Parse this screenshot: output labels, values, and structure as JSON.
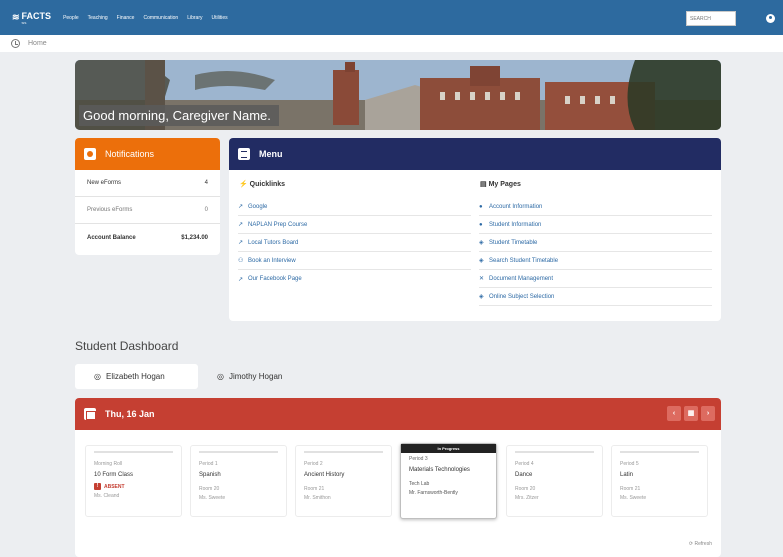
{
  "topbar": {
    "logo": "FACTS",
    "logo_sub": "SIS",
    "nav": [
      "People",
      "Teaching",
      "Finance",
      "Communication",
      "Library",
      "Utilities"
    ],
    "search_placeholder": "SEARCH"
  },
  "breadcrumb": {
    "label": "Home"
  },
  "banner": {
    "greeting": "Good morning, Caregiver Name."
  },
  "notifications": {
    "title": "Notifications",
    "rows": [
      {
        "label": "New eForms",
        "value": "4"
      },
      {
        "label": "Previous eForms",
        "value": "0"
      },
      {
        "label": "Account Balance",
        "value": "$1,234.00"
      }
    ]
  },
  "menu": {
    "title": "Menu",
    "quicklinks": {
      "title": "Quicklinks",
      "items": [
        {
          "icon": "external-link-icon",
          "label": "Google"
        },
        {
          "icon": "external-link-icon",
          "label": "NAPLAN Prep Course"
        },
        {
          "icon": "external-link-icon",
          "label": "Local Tutors Board"
        },
        {
          "icon": "group-icon",
          "label": "Book an Interview"
        },
        {
          "icon": "external-link-icon",
          "label": "Our Facebook Page"
        }
      ]
    },
    "mypages": {
      "title": "My Pages",
      "items": [
        {
          "icon": "account-icon",
          "label": "Account Information"
        },
        {
          "icon": "user-icon",
          "label": "Student Information"
        },
        {
          "icon": "timetable-icon",
          "label": "Student Timetable"
        },
        {
          "icon": "timetable-icon",
          "label": "Search Student Timetable"
        },
        {
          "icon": "document-icon",
          "label": "Document Management"
        },
        {
          "icon": "subject-icon",
          "label": "Online Subject Selection"
        }
      ]
    }
  },
  "dashboard": {
    "title": "Student Dashboard",
    "students": [
      "Elizabeth Hogan",
      "Jimothy Hogan"
    ],
    "date": "Thu, 16 Jan",
    "refresh": "Refresh",
    "periods": [
      {
        "name": "Morning Roll",
        "class": "10 Form Class",
        "status": "ABSENT",
        "room": "",
        "teacher": "Ms. Cleand"
      },
      {
        "name": "Period 1",
        "class": "Spanish",
        "room": "Room 20",
        "teacher": "Ms. Sweete"
      },
      {
        "name": "Period 2",
        "class": "Ancient History",
        "room": "Room 21",
        "teacher": "Mr. Smithon"
      },
      {
        "name": "Period 3",
        "class": "Materials Technologies",
        "room": "Tech Lab",
        "teacher": "Mr. Farnsworth-Bently",
        "progress": "In Progress"
      },
      {
        "name": "Period 4",
        "class": "Dance",
        "room": "Room 20",
        "teacher": "Mrs. Zitzer"
      },
      {
        "name": "Period 5",
        "class": "Latin",
        "room": "Room 21",
        "teacher": "Ms. Sweete"
      }
    ]
  },
  "colors": {
    "topbar": "#2d6a9f",
    "notifications": "#ec6f0b",
    "menu": "#222c63",
    "dashboard": "#c53f32"
  }
}
